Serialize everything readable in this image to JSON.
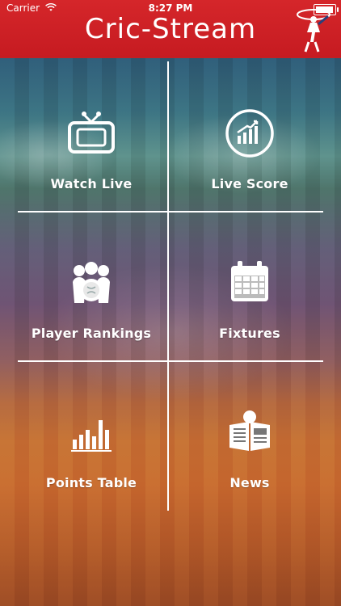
{
  "status_bar": {
    "carrier": "Carrier",
    "time": "8:27 PM"
  },
  "header": {
    "title": "Cric-Stream"
  },
  "tiles": [
    {
      "label": "Watch Live",
      "icon": "tv-icon"
    },
    {
      "label": "Live Score",
      "icon": "chart-circle-icon"
    },
    {
      "label": "Player Rankings",
      "icon": "players-icon"
    },
    {
      "label": "Fixtures",
      "icon": "calendar-icon"
    },
    {
      "label": "Points Table",
      "icon": "bar-chart-icon"
    },
    {
      "label": "News",
      "icon": "news-icon"
    }
  ],
  "colors": {
    "header": "#c61b21",
    "lines": "#ffffff"
  }
}
